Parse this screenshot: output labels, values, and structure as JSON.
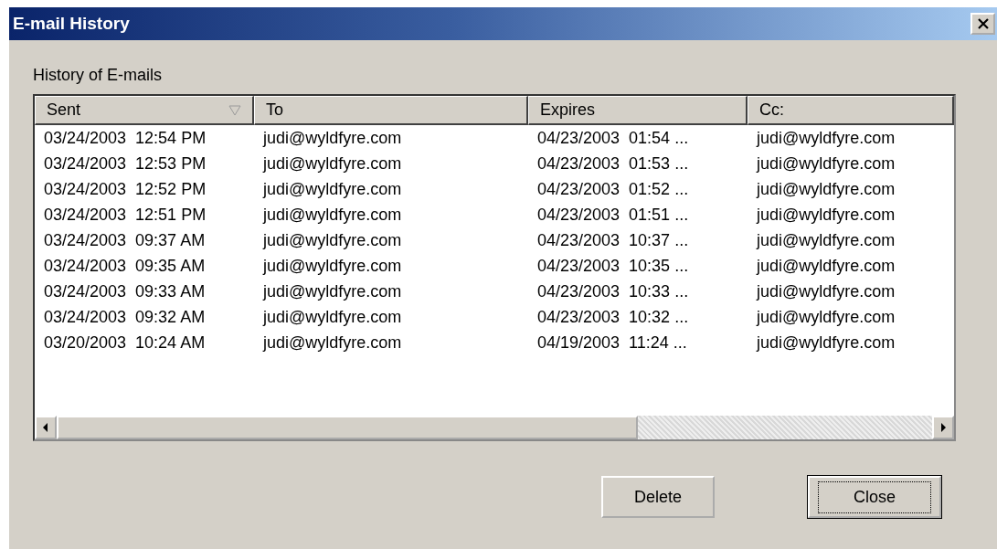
{
  "window": {
    "title": "E-mail History"
  },
  "group_label": "History of E-mails",
  "table": {
    "columns": [
      {
        "label": "Sent",
        "sorted": true
      },
      {
        "label": "To",
        "sorted": false
      },
      {
        "label": "Expires",
        "sorted": false
      },
      {
        "label": "Cc:",
        "sorted": false
      }
    ],
    "rows": [
      [
        "03/24/2003  12:54 PM",
        "judi@wyldfyre.com",
        "04/23/2003  01:54 ...",
        "judi@wyldfyre.com"
      ],
      [
        "03/24/2003  12:53 PM",
        "judi@wyldfyre.com",
        "04/23/2003  01:53 ...",
        "judi@wyldfyre.com"
      ],
      [
        "03/24/2003  12:52 PM",
        "judi@wyldfyre.com",
        "04/23/2003  01:52 ...",
        "judi@wyldfyre.com"
      ],
      [
        "03/24/2003  12:51 PM",
        "judi@wyldfyre.com",
        "04/23/2003  01:51 ...",
        "judi@wyldfyre.com"
      ],
      [
        "03/24/2003  09:37 AM",
        "judi@wyldfyre.com",
        "04/23/2003  10:37 ...",
        "judi@wyldfyre.com"
      ],
      [
        "03/24/2003  09:35 AM",
        "judi@wyldfyre.com",
        "04/23/2003  10:35 ...",
        "judi@wyldfyre.com"
      ],
      [
        "03/24/2003  09:33 AM",
        "judi@wyldfyre.com",
        "04/23/2003  10:33 ...",
        "judi@wyldfyre.com"
      ],
      [
        "03/24/2003  09:32 AM",
        "judi@wyldfyre.com",
        "04/23/2003  10:32 ...",
        "judi@wyldfyre.com"
      ],
      [
        "03/20/2003  10:24 AM",
        "judi@wyldfyre.com",
        "04/19/2003  11:24 ...",
        "judi@wyldfyre.com"
      ]
    ]
  },
  "buttons": [
    {
      "label": "Delete",
      "focused": false
    },
    {
      "label": "Close",
      "focused": true
    }
  ]
}
